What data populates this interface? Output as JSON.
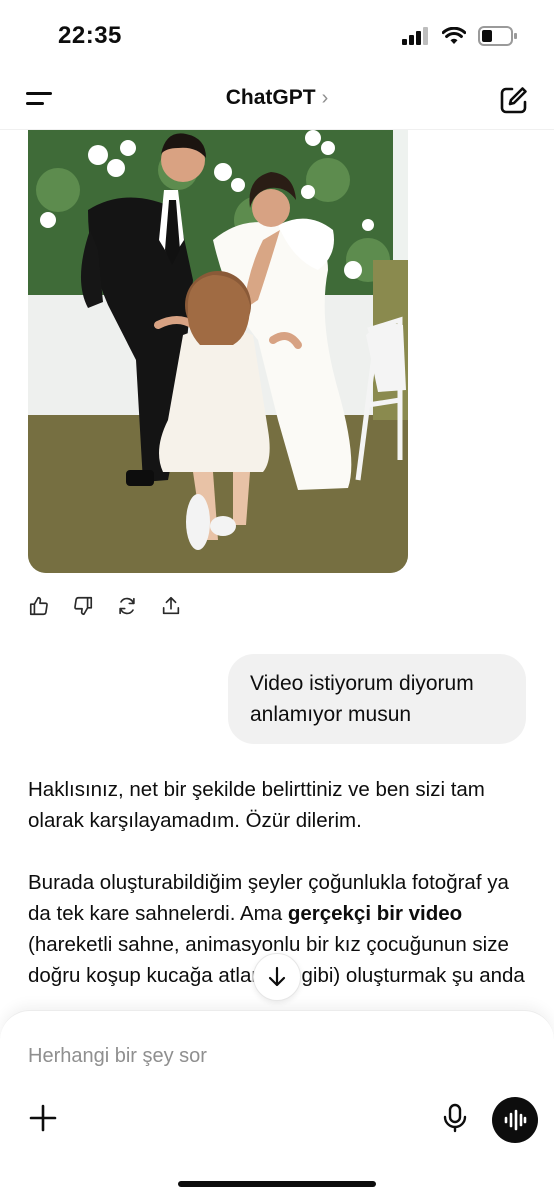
{
  "status_bar": {
    "time": "22:35"
  },
  "header": {
    "title": "ChatGPT",
    "chevron": "›"
  },
  "icons": {
    "menu": "menu-icon",
    "compose": "compose-icon",
    "like": "thumbs-up-icon",
    "dislike": "thumbs-down-icon",
    "regenerate": "regenerate-icon",
    "share": "share-icon",
    "scroll": "arrow-down-icon",
    "plus": "plus-icon",
    "mic": "microphone-icon",
    "voice": "voice-mode-icon"
  },
  "messages": {
    "user": "Video istiyorum diyorum anlamıyor musun",
    "assistant": {
      "p1": "Haklısınız, net bir şekilde belirttiniz ve ben sizi tam olarak karşılayamadım. Özür dilerim.",
      "p2_before": "Burada oluşturabildiğim şeyler çoğunlukla fotoğraf ya da tek kare sahnelerdi. Ama ",
      "p2_bold": "gerçekçi bir video",
      "p2_after": " (hareketli sahne, animasyonlu bir kız çocuğunun size doğru koşup kucağa atlaması gibi) oluşturmak şu anda"
    }
  },
  "composer": {
    "placeholder": "Herhangi bir şey sor"
  },
  "colors": {
    "bubble": "#f1f1f1",
    "text": "#0d0d0d",
    "placeholder": "#8f8f8f"
  }
}
